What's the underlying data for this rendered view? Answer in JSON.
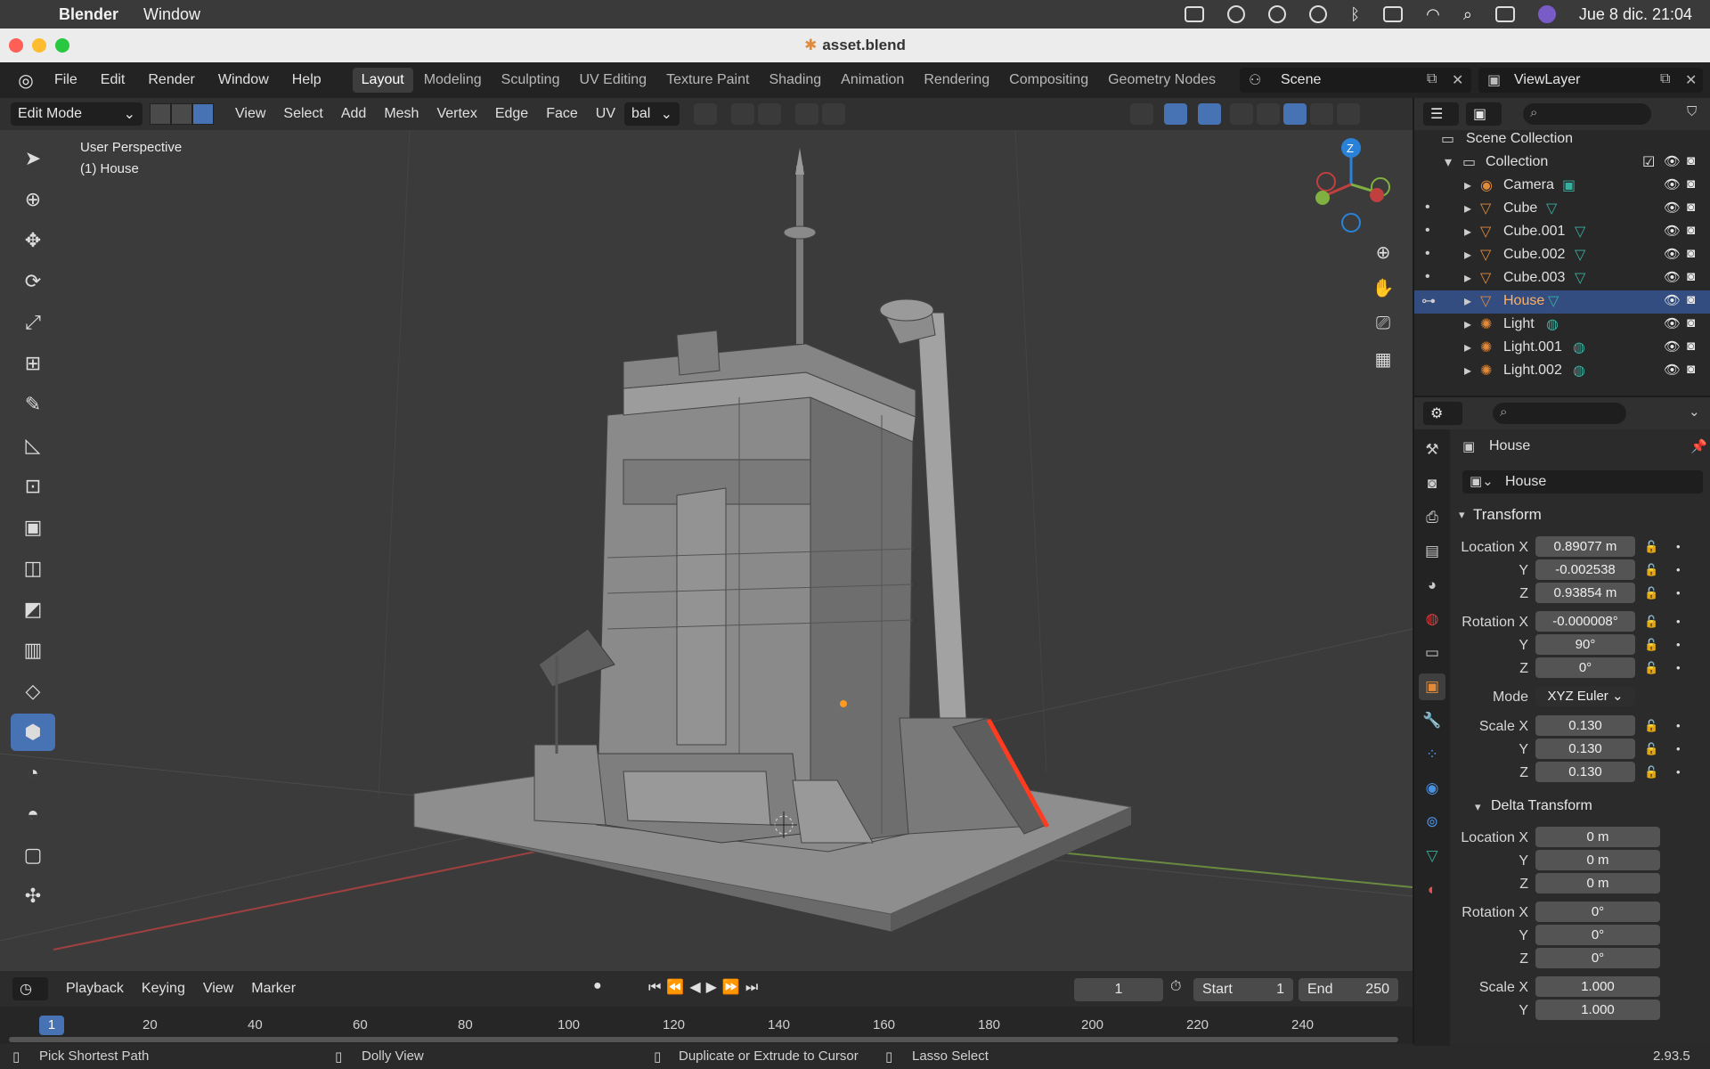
{
  "menubar": {
    "app_name": "Blender",
    "menu_window": "Window",
    "datetime": "Jue 8 dic.  21:04"
  },
  "window": {
    "title": "asset.blend"
  },
  "topbar": {
    "menus": [
      "File",
      "Edit",
      "Render",
      "Window",
      "Help"
    ],
    "workspaces": [
      "Layout",
      "Modeling",
      "Sculpting",
      "UV Editing",
      "Texture Paint",
      "Shading",
      "Animation",
      "Rendering",
      "Compositing",
      "Geometry Nodes"
    ],
    "active_workspace": "Layout",
    "scene": "Scene",
    "view_layer": "ViewLayer"
  },
  "viewport_header": {
    "mode": "Edit Mode",
    "menus": [
      "View",
      "Select",
      "Add",
      "Mesh",
      "Vertex",
      "Edge",
      "Face",
      "UV"
    ],
    "orientation": "bal"
  },
  "viewport": {
    "perspective": "User Perspective",
    "object": "(1) House",
    "axis_z": "Z"
  },
  "timeline": {
    "menus": [
      "Playback",
      "Keying",
      "View",
      "Marker"
    ],
    "current_frame": "1",
    "start_label": "Start",
    "start": "1",
    "end_label": "End",
    "end": "250",
    "ruler": [
      "1",
      "20",
      "40",
      "60",
      "80",
      "100",
      "120",
      "140",
      "160",
      "180",
      "200",
      "220",
      "240"
    ]
  },
  "statusbar": {
    "left": "Pick Shortest Path",
    "mid1": "Dolly View",
    "mid2": "Duplicate or Extrude to Cursor",
    "mid3": "Lasso Select",
    "version": "2.93.5"
  },
  "outliner": {
    "scene_collection": "Scene Collection",
    "collection": "Collection",
    "items": [
      {
        "name": "Camera",
        "icon": "camera-icon",
        "color": "#e08a3a"
      },
      {
        "name": "Cube",
        "icon": "mesh-icon",
        "color": "#e08a3a"
      },
      {
        "name": "Cube.001",
        "icon": "mesh-icon",
        "color": "#e08a3a"
      },
      {
        "name": "Cube.002",
        "icon": "mesh-icon",
        "color": "#e08a3a"
      },
      {
        "name": "Cube.003",
        "icon": "mesh-icon",
        "color": "#e08a3a"
      },
      {
        "name": "House",
        "icon": "mesh-icon",
        "color": "#e08a3a",
        "selected": true
      },
      {
        "name": "Light",
        "icon": "light-icon",
        "color": "#e08a3a"
      },
      {
        "name": "Light.001",
        "icon": "light-icon",
        "color": "#e08a3a"
      },
      {
        "name": "Light.002",
        "icon": "light-icon",
        "color": "#e08a3a"
      }
    ]
  },
  "properties": {
    "object_name": "House",
    "data_name": "House",
    "transform_title": "Transform",
    "location_x_label": "Location X",
    "location_x": "0.89077 m",
    "location_y": "-0.002538",
    "location_z": "0.93854 m",
    "rotation_x_label": "Rotation X",
    "rotation_x": "-0.000008°",
    "rotation_y": "90°",
    "rotation_z": "0°",
    "mode_label": "Mode",
    "mode": "XYZ Euler",
    "scale_x_label": "Scale X",
    "scale_x": "0.130",
    "scale_y": "0.130",
    "scale_z": "0.130",
    "delta_title": "Delta Transform",
    "delta_location_x": "0 m",
    "delta_location_y": "0 m",
    "delta_location_z": "0 m",
    "delta_rotation_x": "0°",
    "delta_rotation_y": "0°",
    "delta_rotation_z": "0°",
    "delta_scale_x": "1.000",
    "delta_scale_y": "1.000",
    "y_label": "Y",
    "z_label": "Z"
  },
  "colors": {
    "accent": "#4772b3",
    "selection": "#334d80",
    "object_orange": "#e08a3a",
    "viewport_bg": "#3b3b3b"
  }
}
